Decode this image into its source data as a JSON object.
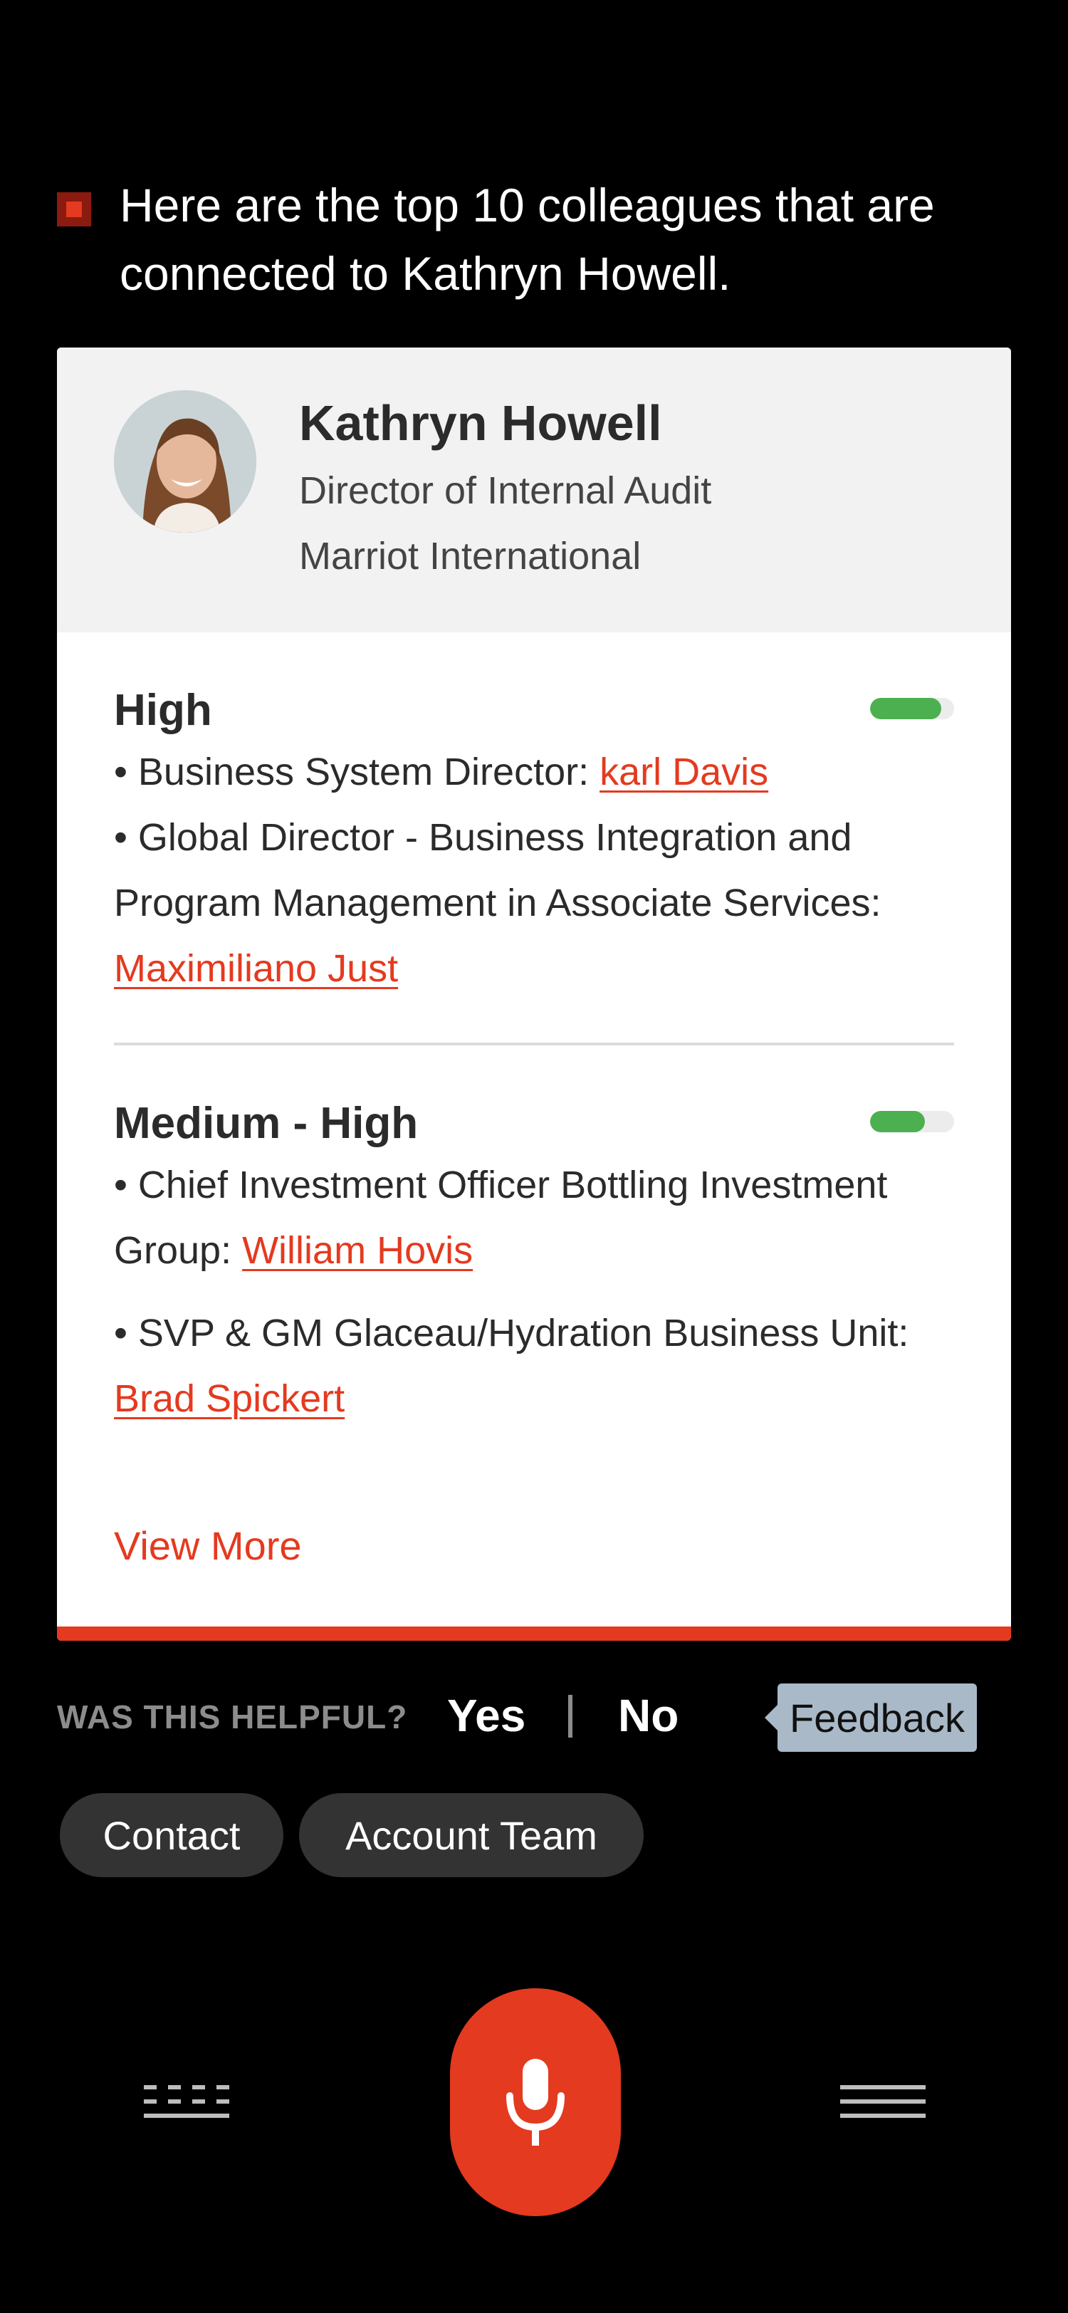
{
  "message": {
    "text": "Here are the top 10 colleagues that are connected to Kathryn Howell."
  },
  "profile": {
    "name": "Kathryn Howell",
    "title": "Director of Internal Audit",
    "company": "Marriot International"
  },
  "sections": [
    {
      "title": "High",
      "strength": 0.85,
      "items": [
        {
          "role": "• Business System Director: ",
          "person": "karl Davis"
        },
        {
          "role": "• Global Director - Business Integration and Program Management in Associate Services: ",
          "person": "Maximiliano Just"
        }
      ]
    },
    {
      "title": "Medium - High",
      "strength": 0.65,
      "items": [
        {
          "role": "• Chief Investment Officer Bottling Investment Group: ",
          "person": "William Hovis"
        },
        {
          "role": "•  SVP & GM Glaceau/Hydration Business Unit: ",
          "person": "Brad Spickert"
        }
      ]
    }
  ],
  "view_more": "View More",
  "feedback_row": {
    "question": "WAS THIS HELPFUL?",
    "yes": "Yes",
    "no": "No",
    "feedback": "Feedback"
  },
  "chips": {
    "contact": "Contact",
    "account_team": "Account Team"
  },
  "colors": {
    "accent": "#e43a1f",
    "meter": "#4cb051",
    "feedback_bg": "#a9b9c7"
  },
  "icons": {
    "keyboard": "keyboard-icon",
    "microphone": "microphone-icon",
    "menu": "menu-icon"
  }
}
